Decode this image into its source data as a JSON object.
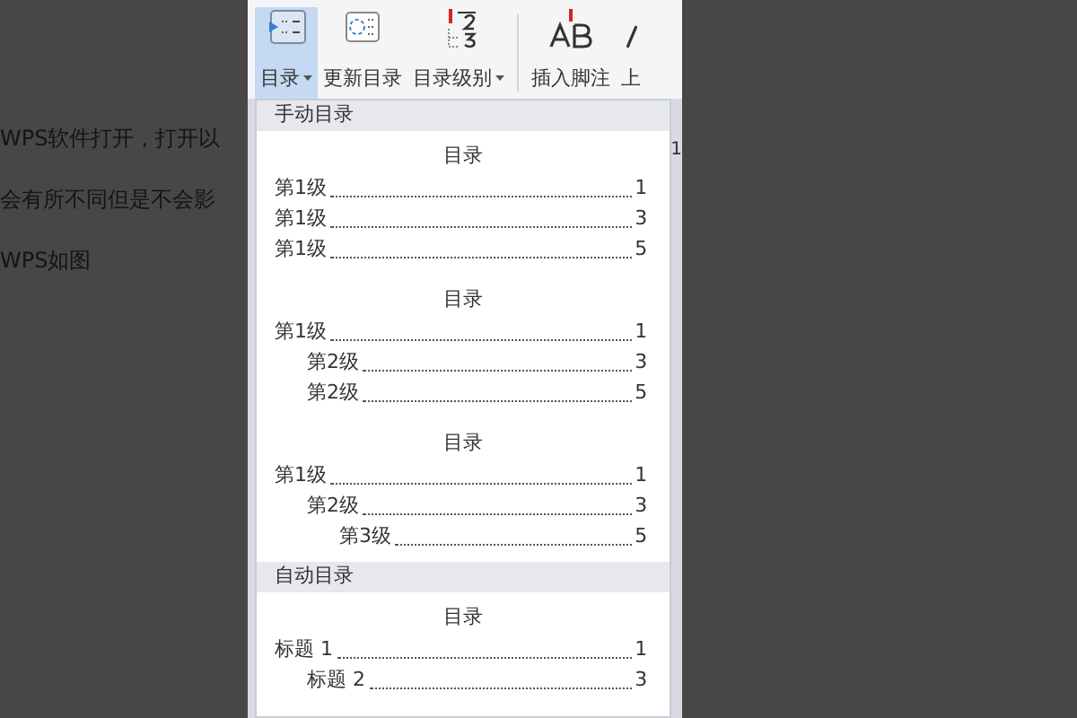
{
  "document_lines": [
    "WPS软件打开，打开以",
    "会有所不同但是不会影",
    "WPS如图"
  ],
  "ribbon": {
    "buttons": [
      {
        "label": "目录",
        "kind": "toc",
        "dropdown": true,
        "selected": true
      },
      {
        "label": "更新目录",
        "kind": "update",
        "dropdown": false,
        "selected": false
      },
      {
        "label": "目录级别",
        "kind": "levels",
        "dropdown": true,
        "selected": false
      },
      {
        "label": "插入脚注",
        "kind": "footnote",
        "dropdown": false,
        "selected": false
      },
      {
        "label": "上",
        "kind": "cut",
        "dropdown": false,
        "selected": false
      }
    ],
    "behind_text": "1"
  },
  "menu": {
    "sections": [
      {
        "header": "手动目录",
        "blocks": [
          {
            "title": "目录",
            "entries": [
              {
                "text": "第1级",
                "page": "1"
              },
              {
                "text": "第1级",
                "page": "3"
              },
              {
                "text": "第1级",
                "page": "5"
              }
            ]
          },
          {
            "title": "目录",
            "entries": [
              {
                "text": "第1级",
                "page": "1",
                "children": [
                  {
                    "text": "第2级",
                    "page": "3"
                  },
                  {
                    "text": "第2级",
                    "page": "5"
                  }
                ]
              }
            ]
          },
          {
            "title": "目录",
            "entries": [
              {
                "text": "第1级",
                "page": "1",
                "children": [
                  {
                    "text": "第2级",
                    "page": "3",
                    "children": [
                      {
                        "text": "第3级",
                        "page": "5"
                      }
                    ]
                  }
                ]
              }
            ]
          }
        ]
      },
      {
        "header": "自动目录",
        "blocks": [
          {
            "title": "目录",
            "entries": [
              {
                "text": "标题 1",
                "page": "1",
                "children": [
                  {
                    "text": "标题 2",
                    "page": "3"
                  }
                ]
              }
            ]
          }
        ]
      }
    ]
  }
}
